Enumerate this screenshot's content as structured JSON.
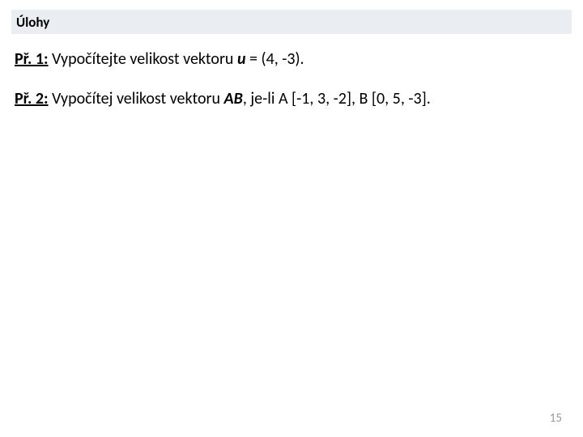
{
  "header": {
    "title": "Úlohy"
  },
  "exercises": [
    {
      "label": "Př. 1:",
      "pre": " Vypočítejte velikost vektoru ",
      "var": "u",
      "post": " = (4, -3)."
    },
    {
      "label": "Př. 2:",
      "pre": " Vypočítej velikost vektoru ",
      "var": "AB",
      "post": ", je-li A [-1, 3, -2], B [0, 5, -3]."
    }
  ],
  "page_number": "15"
}
